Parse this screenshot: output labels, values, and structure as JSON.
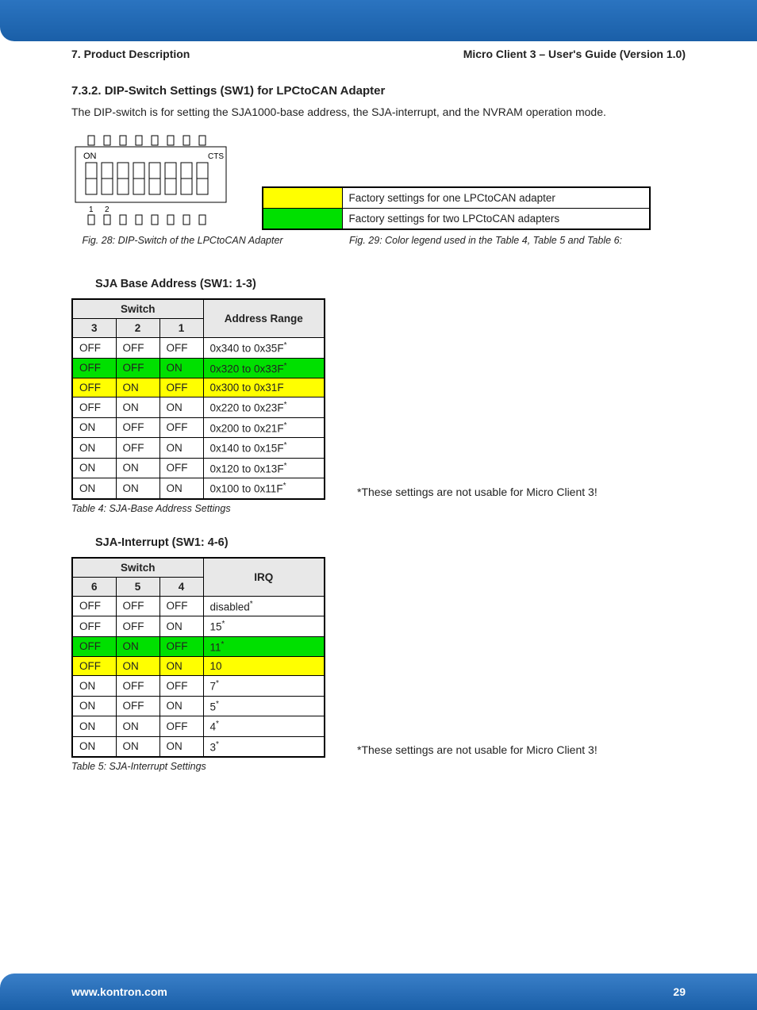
{
  "header": {
    "left": "7. Product Description",
    "right": "Micro Client 3 – User's Guide (Version 1.0)"
  },
  "section": {
    "number_title": "7.3.2. DIP-Switch Settings (SW1) for LPCtoCAN Adapter",
    "intro": "The DIP-switch is for setting the SJA1000-base address, the SJA-interrupt, and the NVRAM operation mode."
  },
  "legend": {
    "yellow": "Factory settings for one LPCtoCAN adapter",
    "green": "Factory settings for two LPCtoCAN adapters"
  },
  "captions": {
    "fig28": "Fig. 28: DIP-Switch of the LPCtoCAN Adapter",
    "fig29": "Fig. 29: Color legend used in the Table 4, Table 5 and Table 6:"
  },
  "table4": {
    "title": "SJA Base Address (SW1: 1-3)",
    "switch_header": "Switch",
    "range_header": "Address Range",
    "cols": [
      "3",
      "2",
      "1"
    ],
    "rows": [
      {
        "c": [
          "OFF",
          "OFF",
          "OFF"
        ],
        "r": "0x340 to 0x35F",
        "star": true,
        "hl": ""
      },
      {
        "c": [
          "OFF",
          "OFF",
          "ON"
        ],
        "r": "0x320 to 0x33F",
        "star": true,
        "hl": "green"
      },
      {
        "c": [
          "OFF",
          "ON",
          "OFF"
        ],
        "r": "0x300 to 0x31F",
        "star": false,
        "hl": "yellow"
      },
      {
        "c": [
          "OFF",
          "ON",
          "ON"
        ],
        "r": "0x220 to 0x23F",
        "star": true,
        "hl": ""
      },
      {
        "c": [
          "ON",
          "OFF",
          "OFF"
        ],
        "r": "0x200 to 0x21F",
        "star": true,
        "hl": ""
      },
      {
        "c": [
          "ON",
          "OFF",
          "ON"
        ],
        "r": "0x140 to 0x15F",
        "star": true,
        "hl": ""
      },
      {
        "c": [
          "ON",
          "ON",
          "OFF"
        ],
        "r": "0x120 to 0x13F",
        "star": true,
        "hl": ""
      },
      {
        "c": [
          "ON",
          "ON",
          "ON"
        ],
        "r": "0x100 to 0x11F",
        "star": true,
        "hl": ""
      }
    ],
    "caption": "Table 4: SJA-Base Address Settings",
    "note": "*These settings are not usable for Micro Client 3!"
  },
  "table5": {
    "title": "SJA-Interrupt (SW1: 4-6)",
    "switch_header": "Switch",
    "irq_header": "IRQ",
    "cols": [
      "6",
      "5",
      "4"
    ],
    "rows": [
      {
        "c": [
          "OFF",
          "OFF",
          "OFF"
        ],
        "r": "disabled",
        "star": true,
        "hl": ""
      },
      {
        "c": [
          "OFF",
          "OFF",
          "ON"
        ],
        "r": "15",
        "star": true,
        "hl": ""
      },
      {
        "c": [
          "OFF",
          "ON",
          "OFF"
        ],
        "r": "11",
        "star": true,
        "hl": "green"
      },
      {
        "c": [
          "OFF",
          "ON",
          "ON"
        ],
        "r": "10",
        "star": false,
        "hl": "yellow"
      },
      {
        "c": [
          "ON",
          "OFF",
          "OFF"
        ],
        "r": "7",
        "star": true,
        "hl": ""
      },
      {
        "c": [
          "ON",
          "OFF",
          "ON"
        ],
        "r": "5",
        "star": true,
        "hl": ""
      },
      {
        "c": [
          "ON",
          "ON",
          "OFF"
        ],
        "r": "4",
        "star": true,
        "hl": ""
      },
      {
        "c": [
          "ON",
          "ON",
          "ON"
        ],
        "r": "3",
        "star": true,
        "hl": ""
      }
    ],
    "caption": "Table 5: SJA-Interrupt Settings",
    "note": "*These settings are not usable for Micro Client 3!"
  },
  "footer": {
    "url": "www.kontron.com",
    "page": "29"
  }
}
